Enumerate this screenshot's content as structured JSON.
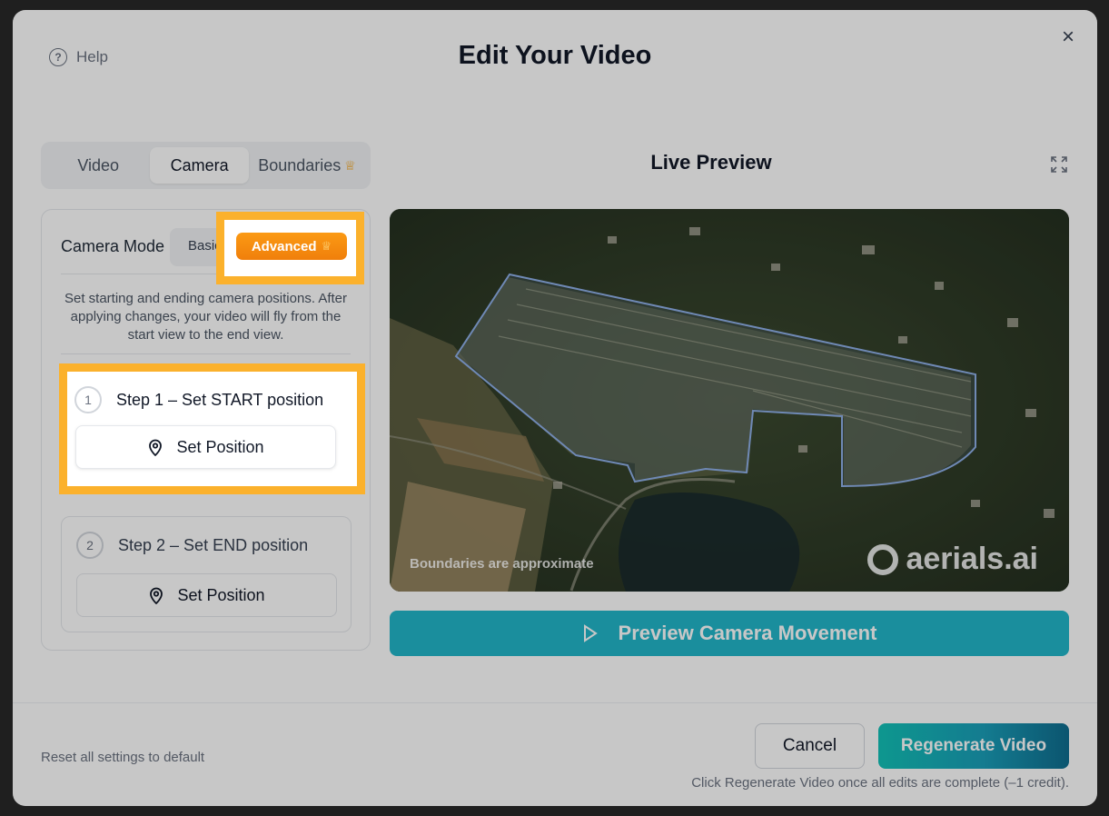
{
  "help_label": "Help",
  "title": "Edit Your Video",
  "close_symbol": "×",
  "tabs": [
    {
      "label": "Video"
    },
    {
      "label": "Camera"
    },
    {
      "label": "Boundaries"
    }
  ],
  "live_preview_title": "Live Preview",
  "camera_mode": {
    "label": "Camera Mode",
    "basic": "Basic",
    "advanced": "Advanced"
  },
  "description": "Set starting and ending camera positions. After applying changes, your video will fly from the start view to the end view.",
  "steps": [
    {
      "number": "1",
      "title": "Step 1 – Set START position",
      "button": "Set Position"
    },
    {
      "number": "2",
      "title": "Step 2 – Set END position",
      "button": "Set Position"
    }
  ],
  "preview": {
    "approx_note": "Boundaries are approximate",
    "brand": "aerials.ai"
  },
  "preview_button": "Preview Camera Movement",
  "footer": {
    "reset": "Reset all settings to default",
    "cancel": "Cancel",
    "regenerate": "Regenerate Video",
    "note": "Click Regenerate Video once all edits are complete (–1 credit)."
  },
  "colors": {
    "accent": "#22b6c9",
    "advanced": "#f7890f",
    "highlight": "#fbb12c"
  },
  "icons": [
    "help-icon",
    "close-icon",
    "crown-icon",
    "expand-icon",
    "map-pin-icon",
    "play-icon",
    "aerials-logo-icon"
  ]
}
